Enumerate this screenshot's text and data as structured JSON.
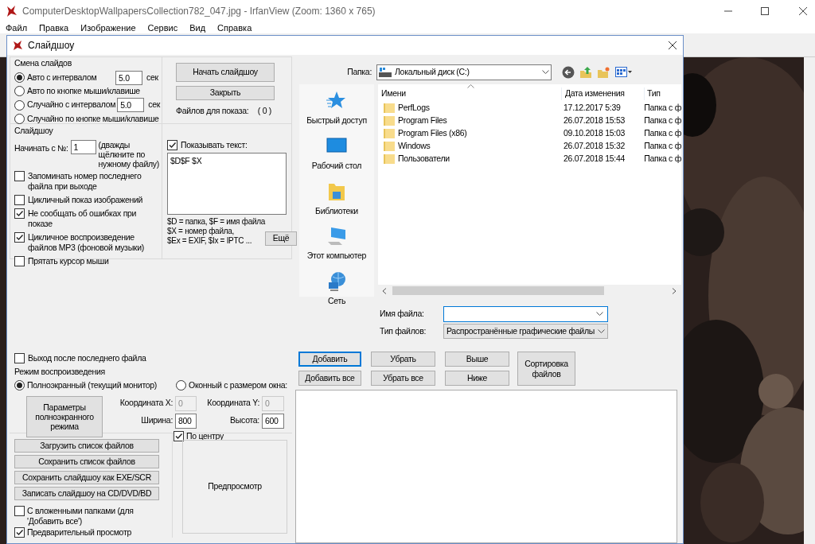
{
  "app": {
    "title": "ComputerDesktopWallpapersCollection782_047.jpg - IrfanView (Zoom: 1360 x 765)",
    "menu": [
      "Файл",
      "Правка",
      "Изображение",
      "Сервис",
      "Вид",
      "Справка"
    ]
  },
  "dialog": {
    "title": "Слайдшоу",
    "slide_change": {
      "legend": "Смена слайдов",
      "options": [
        {
          "label": "Авто с интервалом",
          "selected": true,
          "interval": "5.0",
          "unit": "сек"
        },
        {
          "label": "Авто по кнопке мыши/клавише",
          "selected": false
        },
        {
          "label": "Случайно с интервалом",
          "selected": false,
          "interval": "5.0",
          "unit": "сек"
        },
        {
          "label": "Случайно по кнопке мыши/клавише",
          "selected": false
        }
      ]
    },
    "start_button": "Начать слайдшоу",
    "close_button": "Закрыть",
    "files_label": "Файлов для показа:",
    "files_count": "( 0 )",
    "slideshow": {
      "legend": "Слайдшоу",
      "start_label": "Начинать с №:",
      "start_value": "1",
      "start_hint": "(дважды щёлкните по нужному файлу)",
      "options": [
        {
          "label": "Запоминать номер последнего файла при выходе",
          "checked": false
        },
        {
          "label": "Цикличный показ изображений",
          "checked": false
        },
        {
          "label": "Не сообщать об ошибках при показе",
          "checked": true
        },
        {
          "label": "Цикличное воспроизведение файлов MP3 (фоновой музыки)",
          "checked": true
        },
        {
          "label": "Прятать курсор мыши",
          "checked": false
        }
      ],
      "show_text": {
        "label": "Показывать текст:",
        "checked": true
      },
      "text_value": "$D$F $X",
      "help": [
        "$D = папка, $F = имя файла",
        "$X = номер файла,",
        "$Ex = EXIF, $Ix = IPTC ..."
      ],
      "more_button": "Ещё"
    },
    "exit_after_last": {
      "label": "Выход после последнего файла",
      "checked": false
    },
    "playback": {
      "legend": "Режим воспроизведения",
      "modes": [
        {
          "label": "Полноэкранный (текущий монитор)",
          "selected": true
        },
        {
          "label": "Оконный с размером окна:",
          "selected": false
        }
      ],
      "fullscreen_button": "Параметры полноэкранного режима",
      "fields": [
        {
          "label": "Координата X:",
          "value": "0",
          "disabled": true
        },
        {
          "label": "Координата Y:",
          "value": "0",
          "disabled": true
        },
        {
          "label": "Ширина:",
          "value": "800",
          "disabled": false
        },
        {
          "label": "Высота:",
          "value": "600",
          "disabled": false
        }
      ],
      "center": {
        "label": "По центру",
        "checked": true
      }
    },
    "list_buttons": [
      "Загрузить список файлов",
      "Сохранить список файлов",
      "Сохранить слайдшоу как EXE/SCR",
      "Записать слайдшоу на CD/DVD/BD"
    ],
    "subfolders": {
      "label": "С вложенными папками (для 'Добавить все')",
      "checked": false
    },
    "preview": {
      "label": "Предварительный просмотр",
      "checked": true
    },
    "preview_box": "Предпросмотр",
    "file_dialog": {
      "folder_label": "Папка:",
      "folder": "Локальный диск (C:)",
      "places": [
        {
          "kind": "quick",
          "label": "Быстрый доступ"
        },
        {
          "kind": "desktop",
          "label": "Рабочий стол"
        },
        {
          "kind": "libraries",
          "label": "Библиотеки"
        },
        {
          "kind": "computer",
          "label": "Этот компьютер"
        },
        {
          "kind": "network",
          "label": "Сеть"
        }
      ],
      "columns": [
        "Имени",
        "Дата изменения",
        "Тип"
      ],
      "rows": [
        {
          "name": "PerfLogs",
          "date": "17.12.2017 5:39",
          "type": "Папка с ф"
        },
        {
          "name": "Program Files",
          "date": "26.07.2018 15:53",
          "type": "Папка с ф"
        },
        {
          "name": "Program Files (x86)",
          "date": "09.10.2018 15:03",
          "type": "Папка с ф"
        },
        {
          "name": "Windows",
          "date": "26.07.2018 15:32",
          "type": "Папка с ф"
        },
        {
          "name": "Пользователи",
          "date": "26.07.2018 15:44",
          "type": "Папка с ф"
        }
      ],
      "filename_label": "Имя файла:",
      "filetype_label": "Тип файлов:",
      "filetype": "Распространённые графические файлы"
    },
    "action_buttons": [
      {
        "label": "Добавить",
        "focused": true
      },
      {
        "label": "Убрать",
        "focused": false
      },
      {
        "label": "Выше",
        "focused": false
      },
      {
        "label": "Добавить все",
        "focused": false
      },
      {
        "label": "Убрать все",
        "focused": false
      },
      {
        "label": "Ниже",
        "focused": false
      }
    ],
    "sort_button": "Сортировка файлов"
  }
}
